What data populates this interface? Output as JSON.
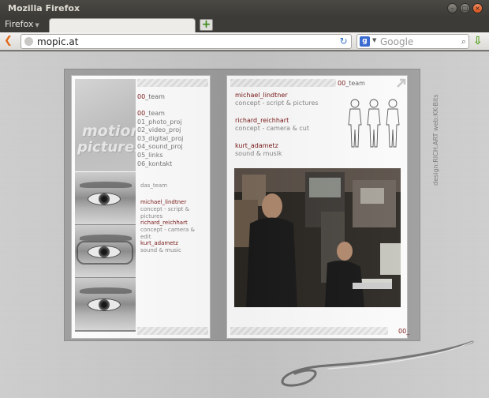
{
  "window": {
    "title": "Mozilla Firefox"
  },
  "tabbar": {
    "menu_label": "Firefox",
    "new_tab": "+"
  },
  "navbar": {
    "url": "mopic.at",
    "search_placeholder": "Google",
    "search_engine_letter": "g"
  },
  "site": {
    "logo": {
      "line1": "motion",
      "line2": "pictures"
    },
    "left_title": {
      "num": "00",
      "text": "_team"
    },
    "nav": [
      {
        "num": "00",
        "text": "_team"
      },
      {
        "num": "",
        "text": "01_photo_proj"
      },
      {
        "num": "",
        "text": "02_video_proj"
      },
      {
        "num": "",
        "text": "03_digital_proj"
      },
      {
        "num": "",
        "text": "04_sound_proj"
      },
      {
        "num": "",
        "text": "05_links"
      },
      {
        "num": "",
        "text": "06_kontakt"
      }
    ],
    "team_heading": "das_team",
    "team_small": [
      {
        "name": "michael_lindtner",
        "role": "concept - script & pictures"
      },
      {
        "name": "richard_reichhart",
        "role": "concept - camera & edit"
      },
      {
        "name": "kurt_adametz",
        "role": "sound & music"
      }
    ],
    "right_num": {
      "num": "00",
      "text": "_team"
    },
    "team": [
      {
        "name": "michael_lindtner",
        "role": "concept - script & pictures"
      },
      {
        "name": "richard_reichhart",
        "role": "concept - camera & cut"
      },
      {
        "name": "kurt_adametz",
        "role": "sound & musik"
      }
    ],
    "footer_num": "00_",
    "credit": "design:RICH.ART  web:KK-Bits"
  },
  "colors": {
    "accent": "#7a1414",
    "text_gray": "#888888"
  }
}
